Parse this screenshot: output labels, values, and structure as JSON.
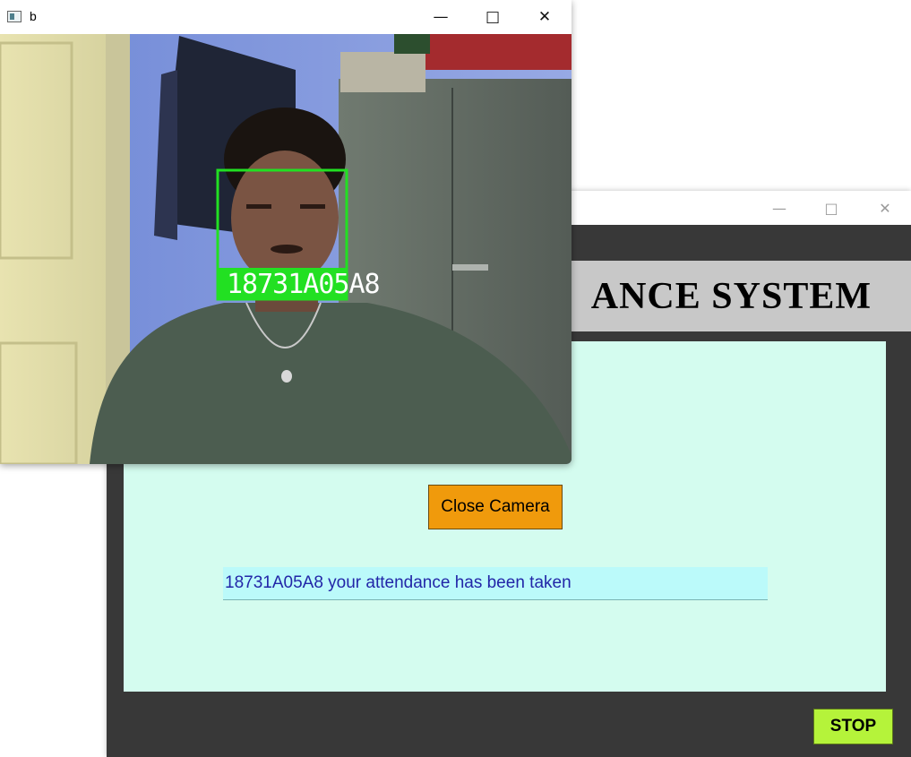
{
  "app_window": {
    "banner_title": "ANCE SYSTEM",
    "titlebar": {
      "minimize_icon": "minimize-icon",
      "maximize_icon": "maximize-icon",
      "close_icon": "close-icon"
    },
    "close_camera_label": "Close Camera",
    "status_message": "18731A05A8 your attendance has been taken",
    "stop_label": "STOP",
    "colors": {
      "frame": "#383838",
      "banner": "#c8c8c8",
      "panel": "#d4fcef",
      "close_camera_button": "#f09a0c",
      "status_field": "#bbfafa",
      "status_text": "#2226a8",
      "stop_button": "#b5f33a"
    }
  },
  "camera_window": {
    "title": "b",
    "app_icon": "opencv-window-icon",
    "recognized_id": "18731A05A8",
    "face_box_color": "#22e022"
  }
}
